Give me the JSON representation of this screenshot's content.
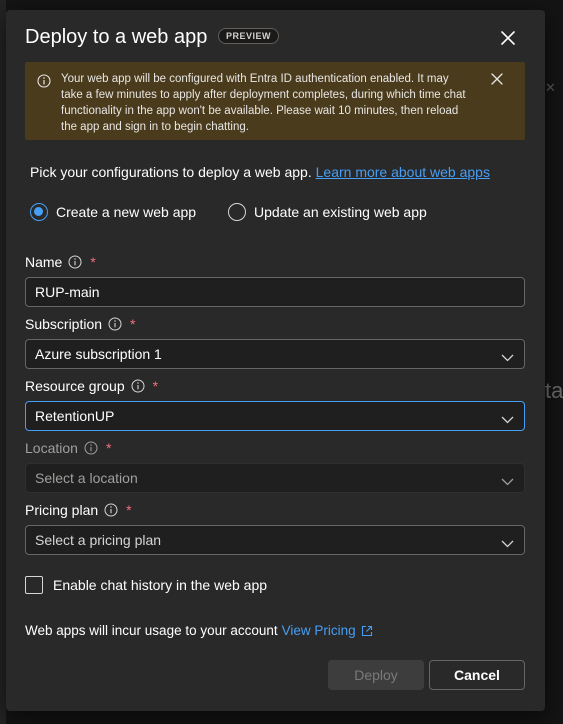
{
  "dialog": {
    "title": "Deploy to a web app",
    "badge": "PREVIEW"
  },
  "warning": {
    "text": "Your web app will be configured with Entra ID authentication enabled. It may take a few minutes to apply after deployment completes, during which time chat functionality in the app won't be available. Please wait 10 minutes, then reload the app and sign in to begin chatting."
  },
  "intro": {
    "text": "Pick your configurations to deploy a web app.",
    "link": "Learn more about web apps"
  },
  "mode": {
    "create_label": "Create a new web app",
    "update_label": "Update an existing web app",
    "selected": "create"
  },
  "fields": {
    "name": {
      "label": "Name",
      "value": "RUP-main"
    },
    "subscription": {
      "label": "Subscription",
      "value": "Azure subscription 1"
    },
    "resource_group": {
      "label": "Resource group",
      "value": "RetentionUP"
    },
    "location": {
      "label": "Location",
      "placeholder": "Select a location"
    },
    "pricing_plan": {
      "label": "Pricing plan",
      "placeholder": "Select a pricing plan"
    }
  },
  "required_mark": "*",
  "chat_history": {
    "label": "Enable chat history in the web app",
    "checked": false
  },
  "usage": {
    "text": "Web apps will incur usage to your account",
    "link": "View Pricing"
  },
  "buttons": {
    "deploy": "Deploy",
    "cancel": "Cancel"
  },
  "background": {
    "fragment_right": "ta"
  },
  "colors": {
    "accent": "#479ef5",
    "dialog_bg": "#292929",
    "warning_bg": "#4a3b1c",
    "required": "#f1707b"
  }
}
